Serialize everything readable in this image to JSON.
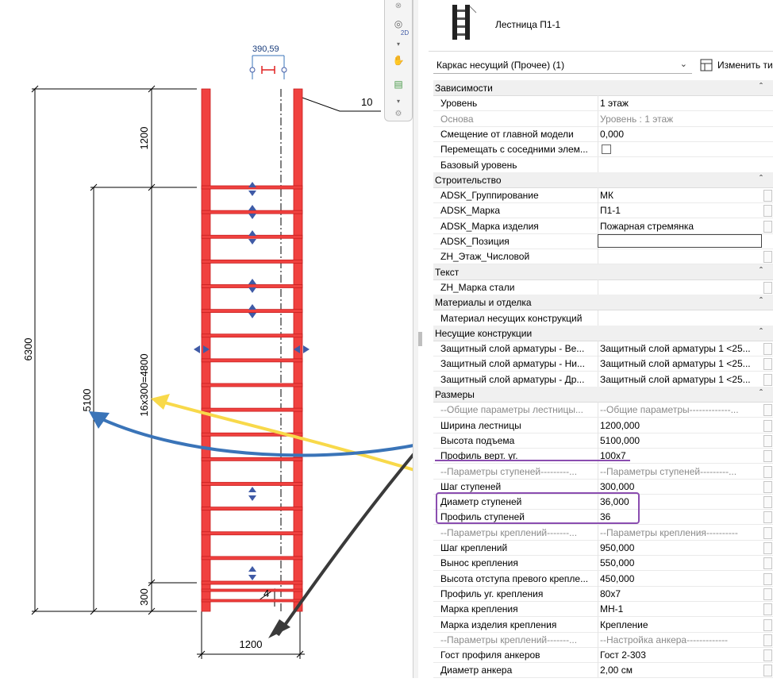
{
  "drawing": {
    "dim_top": "390,59",
    "tag_10": "10",
    "dim_1200_upper": "1200",
    "dim_total": "6300",
    "dim_5100": "5100",
    "dim_steps": "16x300=4800",
    "dim_300": "300",
    "label_4": "4",
    "dim_width": "1200",
    "colors": {
      "ladder": "#f0413f",
      "ladder_dark": "#c81e1e",
      "dim": "#000000",
      "arrow_yellow": "#f8d94a",
      "arrow_blue": "#3a74b8",
      "arrow_black": "#3a3a3a",
      "grip": "#3f5aa6",
      "highlight": "#8a4db0"
    }
  },
  "navbar": {
    "icons": [
      "close-icon",
      "steering-wheel-icon",
      "dropdown-icon",
      "pan-icon",
      "zoom-region-icon",
      "dropdown-icon",
      "gear-icon"
    ],
    "badge": "2D"
  },
  "properties": {
    "type_name": "Лестница П1-1",
    "selector": "Каркас несущий (Прочее) (1)",
    "edit_type": "Изменить ти",
    "rows": [
      {
        "kind": "group",
        "name": "Зависимости"
      },
      {
        "kind": "param",
        "name": "Уровень",
        "value": "1 этаж"
      },
      {
        "kind": "param",
        "name": "Основа",
        "value": "Уровень : 1 этаж",
        "grey": true
      },
      {
        "kind": "param",
        "name": "Смещение от главной модели",
        "value": "0,000"
      },
      {
        "kind": "param",
        "name": "Перемещать с соседними элем...",
        "value": "",
        "checkbox": true
      },
      {
        "kind": "param",
        "name": "Базовый уровень",
        "value": ""
      },
      {
        "kind": "group",
        "name": "Строительство"
      },
      {
        "kind": "param",
        "name": "ADSK_Группирование",
        "value": "МК",
        "side": true
      },
      {
        "kind": "param",
        "name": "ADSK_Марка",
        "value": "П1-1",
        "side": true
      },
      {
        "kind": "param",
        "name": "ADSK_Марка изделия",
        "value": "Пожарная стремянка",
        "side": true
      },
      {
        "kind": "param",
        "name": "ADSK_Позиция",
        "value": "",
        "editing": true
      },
      {
        "kind": "param",
        "name": "ZH_Этаж_Числовой",
        "value": "",
        "side": true
      },
      {
        "kind": "group",
        "name": "Текст"
      },
      {
        "kind": "param",
        "name": "ZH_Марка стали",
        "value": "",
        "side": true
      },
      {
        "kind": "group",
        "name": "Материалы и отделка"
      },
      {
        "kind": "param",
        "name": "Материал несущих конструкций",
        "value": ""
      },
      {
        "kind": "group",
        "name": "Несущие конструкции"
      },
      {
        "kind": "param",
        "name": "Защитный слой арматуры - Ве...",
        "value": "Защитный слой арматуры 1 <25...",
        "side": true
      },
      {
        "kind": "param",
        "name": "Защитный слой арматуры - Ни...",
        "value": "Защитный слой арматуры 1 <25...",
        "side": true
      },
      {
        "kind": "param",
        "name": "Защитный слой арматуры - Др...",
        "value": "Защитный слой арматуры 1 <25...",
        "side": true
      },
      {
        "kind": "group",
        "name": "Размеры"
      },
      {
        "kind": "param",
        "name": "--Общие параметры лестницы...",
        "value": "--Общие параметры-------------...",
        "grey": true,
        "side": true
      },
      {
        "kind": "param",
        "name": "Ширина лестницы",
        "value": "1200,000",
        "side": true
      },
      {
        "kind": "param",
        "name": "Высота подъема",
        "value": "5100,000",
        "side": true
      },
      {
        "kind": "param",
        "name": "Профиль верт. уг.",
        "value": "100x7",
        "side": true
      },
      {
        "kind": "param",
        "name": "--Параметры ступеней---------...",
        "value": "--Параметры ступеней---------...",
        "grey": true,
        "side": true
      },
      {
        "kind": "param",
        "name": "Шаг ступеней",
        "value": "300,000",
        "side": true
      },
      {
        "kind": "param",
        "name": "Диаметр ступеней",
        "value": "36,000",
        "side": true
      },
      {
        "kind": "param",
        "name": "Профиль ступеней",
        "value": "36",
        "side": true
      },
      {
        "kind": "param",
        "name": "--Параметры креплений-------...",
        "value": "--Параметры крепления----------",
        "grey": true,
        "side": true
      },
      {
        "kind": "param",
        "name": "Шаг креплений",
        "value": "950,000",
        "side": true
      },
      {
        "kind": "param",
        "name": "Вынос крепления",
        "value": "550,000",
        "side": true
      },
      {
        "kind": "param",
        "name": "Высота отступа превого крепле...",
        "value": "450,000",
        "side": true
      },
      {
        "kind": "param",
        "name": "Профиль уг. крепления",
        "value": "80x7",
        "side": true
      },
      {
        "kind": "param",
        "name": "Марка крепления",
        "value": "МН-1",
        "side": true
      },
      {
        "kind": "param",
        "name": "Марка изделия крепления",
        "value": "Крепление",
        "side": true
      },
      {
        "kind": "param",
        "name": "--Параметры креплений-------...",
        "value": "--Настройка анкера-------------",
        "grey": true,
        "side": true
      },
      {
        "kind": "param",
        "name": "Гост профиля анкеров",
        "value": "Гост 2-303",
        "side": true
      },
      {
        "kind": "param",
        "name": "Диаметр анкера",
        "value": "2,00 см",
        "side": true
      }
    ]
  }
}
